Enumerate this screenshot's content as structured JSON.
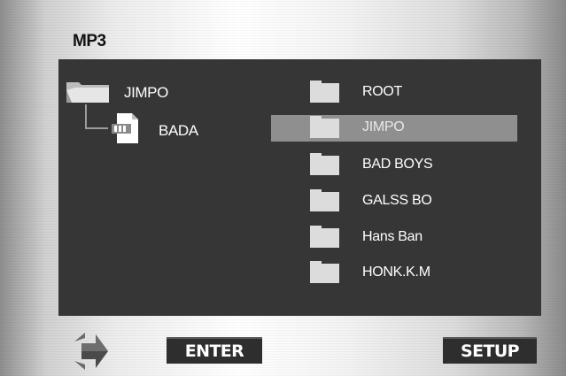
{
  "title": "MP3",
  "tree": {
    "root": {
      "label": "JIMPO",
      "icon": "folder-open-icon"
    },
    "child": {
      "label": "BADA",
      "icon": "mp3-file-icon"
    }
  },
  "list": {
    "items": [
      {
        "label": "ROOT",
        "selected": false
      },
      {
        "label": "JIMPO",
        "selected": true
      },
      {
        "label": "BAD BOYS",
        "selected": false
      },
      {
        "label": "GALSS BO",
        "selected": false
      },
      {
        "label": "Hans Ban",
        "selected": false
      },
      {
        "label": "HONK.K.M",
        "selected": false
      }
    ]
  },
  "controls": {
    "navigation_icon": "directional-arrows-icon",
    "enter_label": "ENTER",
    "setup_label": "SETUP"
  },
  "colors": {
    "panel": "#363636",
    "selection": "#8f8f8f",
    "folder": "#dcdcdc",
    "button": "#2e2e2e"
  }
}
